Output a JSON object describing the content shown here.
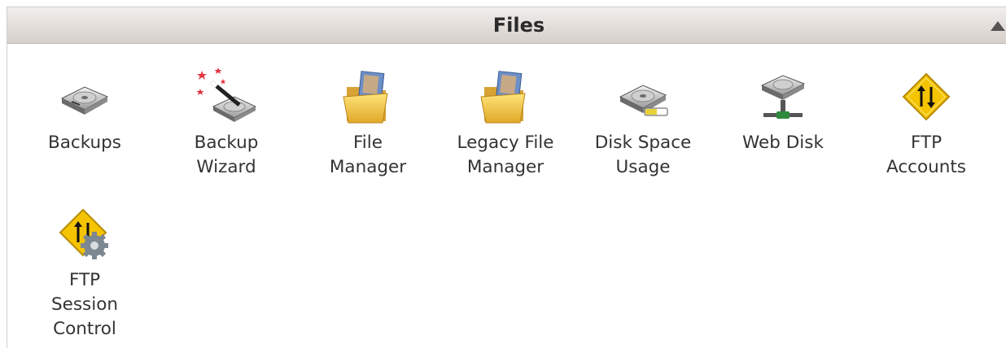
{
  "panel": {
    "title": "Files",
    "collapse_icon": "triangle-up-icon"
  },
  "items": [
    {
      "label": "Backups",
      "icon": "backup-disk-icon"
    },
    {
      "label": "Backup\nWizard",
      "icon": "backup-wizard-icon"
    },
    {
      "label": "File\nManager",
      "icon": "file-manager-folder-icon"
    },
    {
      "label": "Legacy File\nManager",
      "icon": "legacy-file-manager-folder-icon"
    },
    {
      "label": "Disk Space\nUsage",
      "icon": "disk-space-usage-icon"
    },
    {
      "label": "Web Disk",
      "icon": "web-disk-icon"
    },
    {
      "label": "FTP\nAccounts",
      "icon": "ftp-accounts-icon"
    },
    {
      "label": "FTP\nSession\nControl",
      "icon": "ftp-session-control-icon"
    }
  ],
  "colors": {
    "header_top": "#f1eeec",
    "header_bottom": "#d6cfca",
    "label_text": "#333333",
    "folder_yellow": "#f2c64a",
    "ftp_sign": "#f5c400"
  }
}
